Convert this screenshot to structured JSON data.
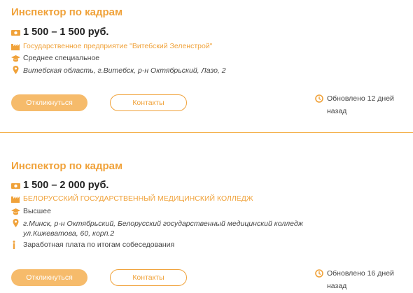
{
  "vacancies": [
    {
      "title": "Инспектор по кадрам",
      "salary": "1 500 – 1 500 руб.",
      "employer": "Государственное предприятие \"Витебский Зеленстрой\"",
      "education": "Среднее специальное",
      "address": "Витебская область, г.Витебск, р-н Октябрьский, Лазо, 2",
      "apply_label": "Откликнуться",
      "contacts_label": "Контакты",
      "updated": "Обновлено 12 дней назад"
    },
    {
      "title": "Инспектор по кадрам",
      "salary": "1 500 – 2 000 руб.",
      "employer": "БЕЛОРУССКИЙ ГОСУДАРСТВЕННЫЙ МЕДИЦИНСКИЙ КОЛЛЕДЖ",
      "education": "Высшее",
      "address_line1": "г.Минск, р-н Октябрьский, Белорусский государственный медицинский колледж",
      "address_line2": "ул.Кижеватова, 60, корп.2",
      "salary_note": "Заработная плата по итогам собеседования",
      "apply_label": "Откликнуться",
      "contacts_label": "Контакты",
      "updated": "Обновлено 16 дней назад"
    }
  ],
  "icons": {
    "salary": "money-icon",
    "employer": "building-icon",
    "education": "graduation-cap-icon",
    "address": "location-pin-icon",
    "info": "info-icon",
    "updated": "clock-icon"
  },
  "colors": {
    "accent": "#f0a23a",
    "button_fill": "#f6bb6b",
    "divider": "#f4b24e"
  }
}
